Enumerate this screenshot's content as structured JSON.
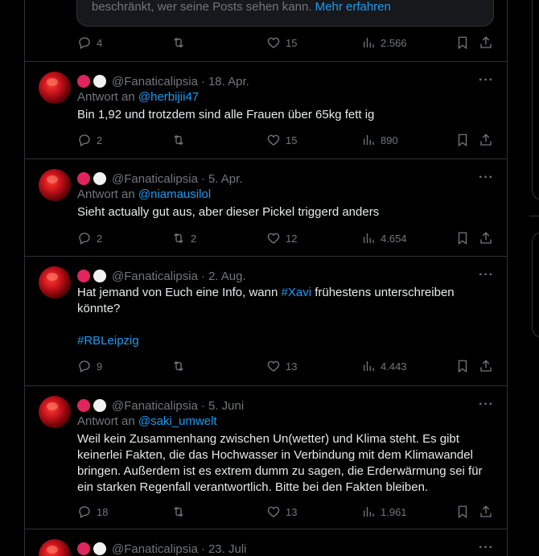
{
  "top": {
    "notice_text": "beschränkt, wer seine Posts sehen kann. ",
    "notice_link": "Mehr erfahren",
    "replies": "4",
    "retweets": "",
    "likes": "15",
    "views": "2.566"
  },
  "reply_prefix": "Antwort an",
  "more": "···",
  "sep": "·",
  "tweets": [
    {
      "handle": "@Fanaticalipsia",
      "date": "18. Apr.",
      "reply_to": "@herbijii47",
      "text": "Bin 1,92 und trotzdem sind alle Frauen über 65kg fett ig",
      "replies": "2",
      "retweets": "",
      "likes": "15",
      "views": "890"
    },
    {
      "handle": "@Fanaticalipsia",
      "date": "5. Apr.",
      "reply_to": "@niamausilol",
      "text": "Sieht actually gut aus, aber dieser Pickel triggerd anders",
      "replies": "2",
      "retweets": "2",
      "likes": "12",
      "views": "4.654"
    },
    {
      "handle": "@Fanaticalipsia",
      "date": "2. Aug.",
      "text_before": "Hat jemand von Euch eine Info, wann ",
      "hashtag1": "#Xavi",
      "text_after": " frühestens unterschreiben könnte?",
      "hashtag2": "#RBLeipzig",
      "replies": "9",
      "retweets": "",
      "likes": "13",
      "views": "4.443"
    },
    {
      "handle": "@Fanaticalipsia",
      "date": "5. Juni",
      "reply_to": "@saki_umwelt",
      "text": "Weil kein Zusammenhang zwischen Un(wetter) und Klima steht. Es gibt keinerlei Fakten, die das Hochwasser in Verbindung mit dem Klimawandel bringen. Außerdem ist es extrem dumm zu sagen, die Erderwärmung sei für ein starken Regenfall verantwortlich. Bitte bei den Fakten bleiben.",
      "replies": "18",
      "retweets": "",
      "likes": "13",
      "views": "1.961"
    },
    {
      "handle": "@Fanaticalipsia",
      "date": "23. Juli"
    }
  ],
  "colors": {
    "background": "#000000",
    "text": "#e7e9ea",
    "muted": "#71767b",
    "link": "#1d9bf0",
    "border": "#2f3336",
    "badge_red": "#e0245e",
    "badge_white": "#f2f2f2"
  }
}
